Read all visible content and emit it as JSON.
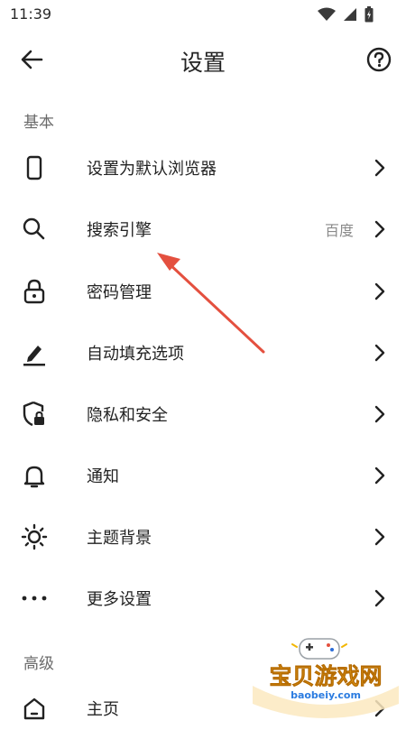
{
  "status_bar": {
    "time": "11:39"
  },
  "app_bar": {
    "title": "设置"
  },
  "sections": {
    "basic": "基本",
    "advanced": "高级"
  },
  "items": [
    {
      "label": "设置为默认浏览器",
      "value": "",
      "icon": "phone-icon"
    },
    {
      "label": "搜索引擎",
      "value": "百度",
      "icon": "search-icon"
    },
    {
      "label": "密码管理",
      "value": "",
      "icon": "lock-icon"
    },
    {
      "label": "自动填充选项",
      "value": "",
      "icon": "pen-icon"
    },
    {
      "label": "隐私和安全",
      "value": "",
      "icon": "shield-lock-icon"
    },
    {
      "label": "通知",
      "value": "",
      "icon": "bell-icon"
    },
    {
      "label": "主题背景",
      "value": "",
      "icon": "sun-icon"
    },
    {
      "label": "更多设置",
      "value": "",
      "icon": "more-dots-icon"
    }
  ],
  "advanced_items": [
    {
      "label": "主页",
      "icon": "home-icon"
    }
  ],
  "watermark": {
    "title": "宝贝游戏网",
    "url": "baobeiy.com"
  },
  "colors": {
    "accent": "#e4503f",
    "watermark": "#e8a21c"
  }
}
